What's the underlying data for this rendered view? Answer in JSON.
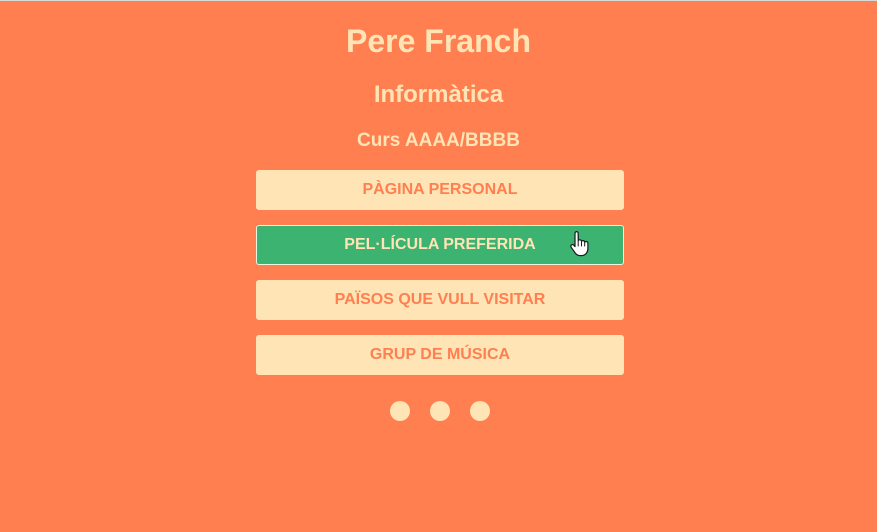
{
  "header": {
    "name": "Pere Franch",
    "subject": "Informàtica",
    "course": "Curs AAAA/BBBB"
  },
  "menu": {
    "items": [
      {
        "label": "PÀGINA PERSONAL",
        "active": false
      },
      {
        "label": "PEL·LÍCULA PREFERIDA",
        "active": true
      },
      {
        "label": "PAÏSOS QUE VULL VISITAR",
        "active": false
      },
      {
        "label": "GRUP DE MÚSICA",
        "active": false
      }
    ]
  },
  "pager": {
    "dots": 3
  },
  "colors": {
    "background": "#ff7f50",
    "text": "#ffe4b5",
    "button": "#ffe4b5",
    "button_text": "#ff7f50",
    "active_button": "#3cb371"
  },
  "icons": {
    "cursor": "hand-pointer-icon"
  }
}
